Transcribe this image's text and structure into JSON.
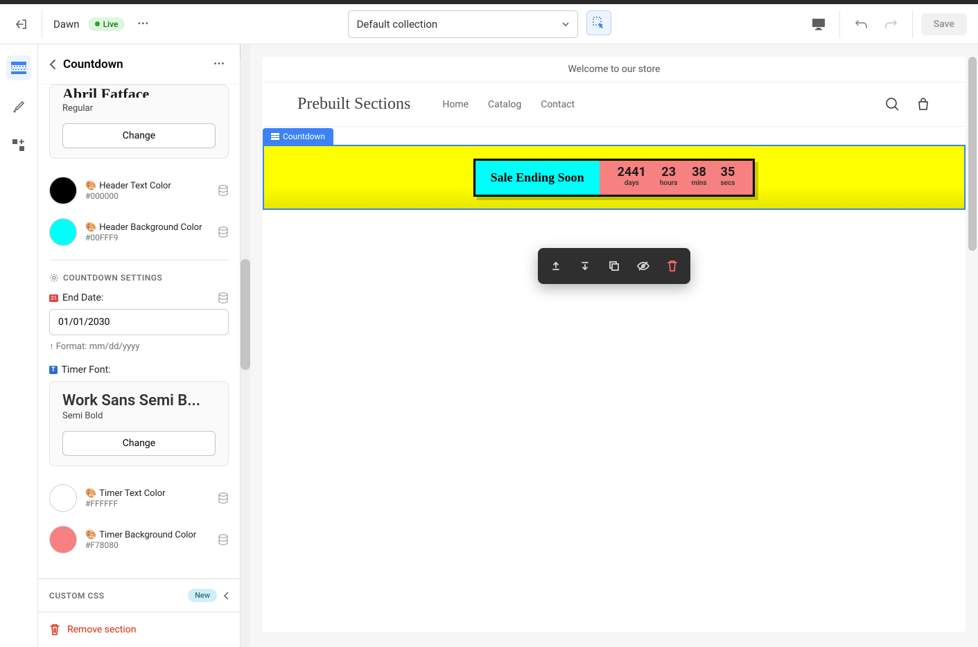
{
  "topbar": {
    "theme_name": "Dawn",
    "live_label": "Live",
    "collection": "Default collection",
    "save_label": "Save"
  },
  "sidebar": {
    "title": "Countdown",
    "font1_name": "Abril Fatface",
    "font1_style": "Regular",
    "change_label": "Change",
    "header_text_color_label": "Header Text Color",
    "header_text_color": "#000000",
    "header_bg_color_label": "Header Background Color",
    "header_bg_color": "#00FFF9",
    "countdown_settings_label": "COUNTDOWN SETTINGS",
    "end_date_label": "End Date:",
    "end_date_value": "01/01/2030",
    "format_help": "↑ Format: mm/dd/yyyy",
    "timer_font_label": "Timer Font:",
    "font2_name": "Work Sans Semi B...",
    "font2_style": "Semi Bold",
    "timer_text_color_label": "Timer Text Color",
    "timer_text_color": "#FFFFFF",
    "timer_bg_color_label": "Timer Background Color",
    "timer_bg_color": "#F78080",
    "custom_css_label": "CUSTOM CSS",
    "new_badge": "New",
    "remove_label": "Remove section"
  },
  "preview": {
    "announcement": "Welcome to our store",
    "store_title": "Prebuilt Sections",
    "nav": {
      "home": "Home",
      "catalog": "Catalog",
      "contact": "Contact"
    },
    "section_tag": "Countdown",
    "sale_text": "Sale Ending Soon",
    "timer": {
      "days_n": "2441",
      "days_l": "days",
      "hours_n": "23",
      "hours_l": "hours",
      "mins_n": "38",
      "mins_l": "mins",
      "secs_n": "35",
      "secs_l": "secs"
    }
  },
  "colors": {
    "black": "#000000",
    "cyan": "#00FFF9",
    "white": "#FFFFFF",
    "coral": "#F78080"
  }
}
